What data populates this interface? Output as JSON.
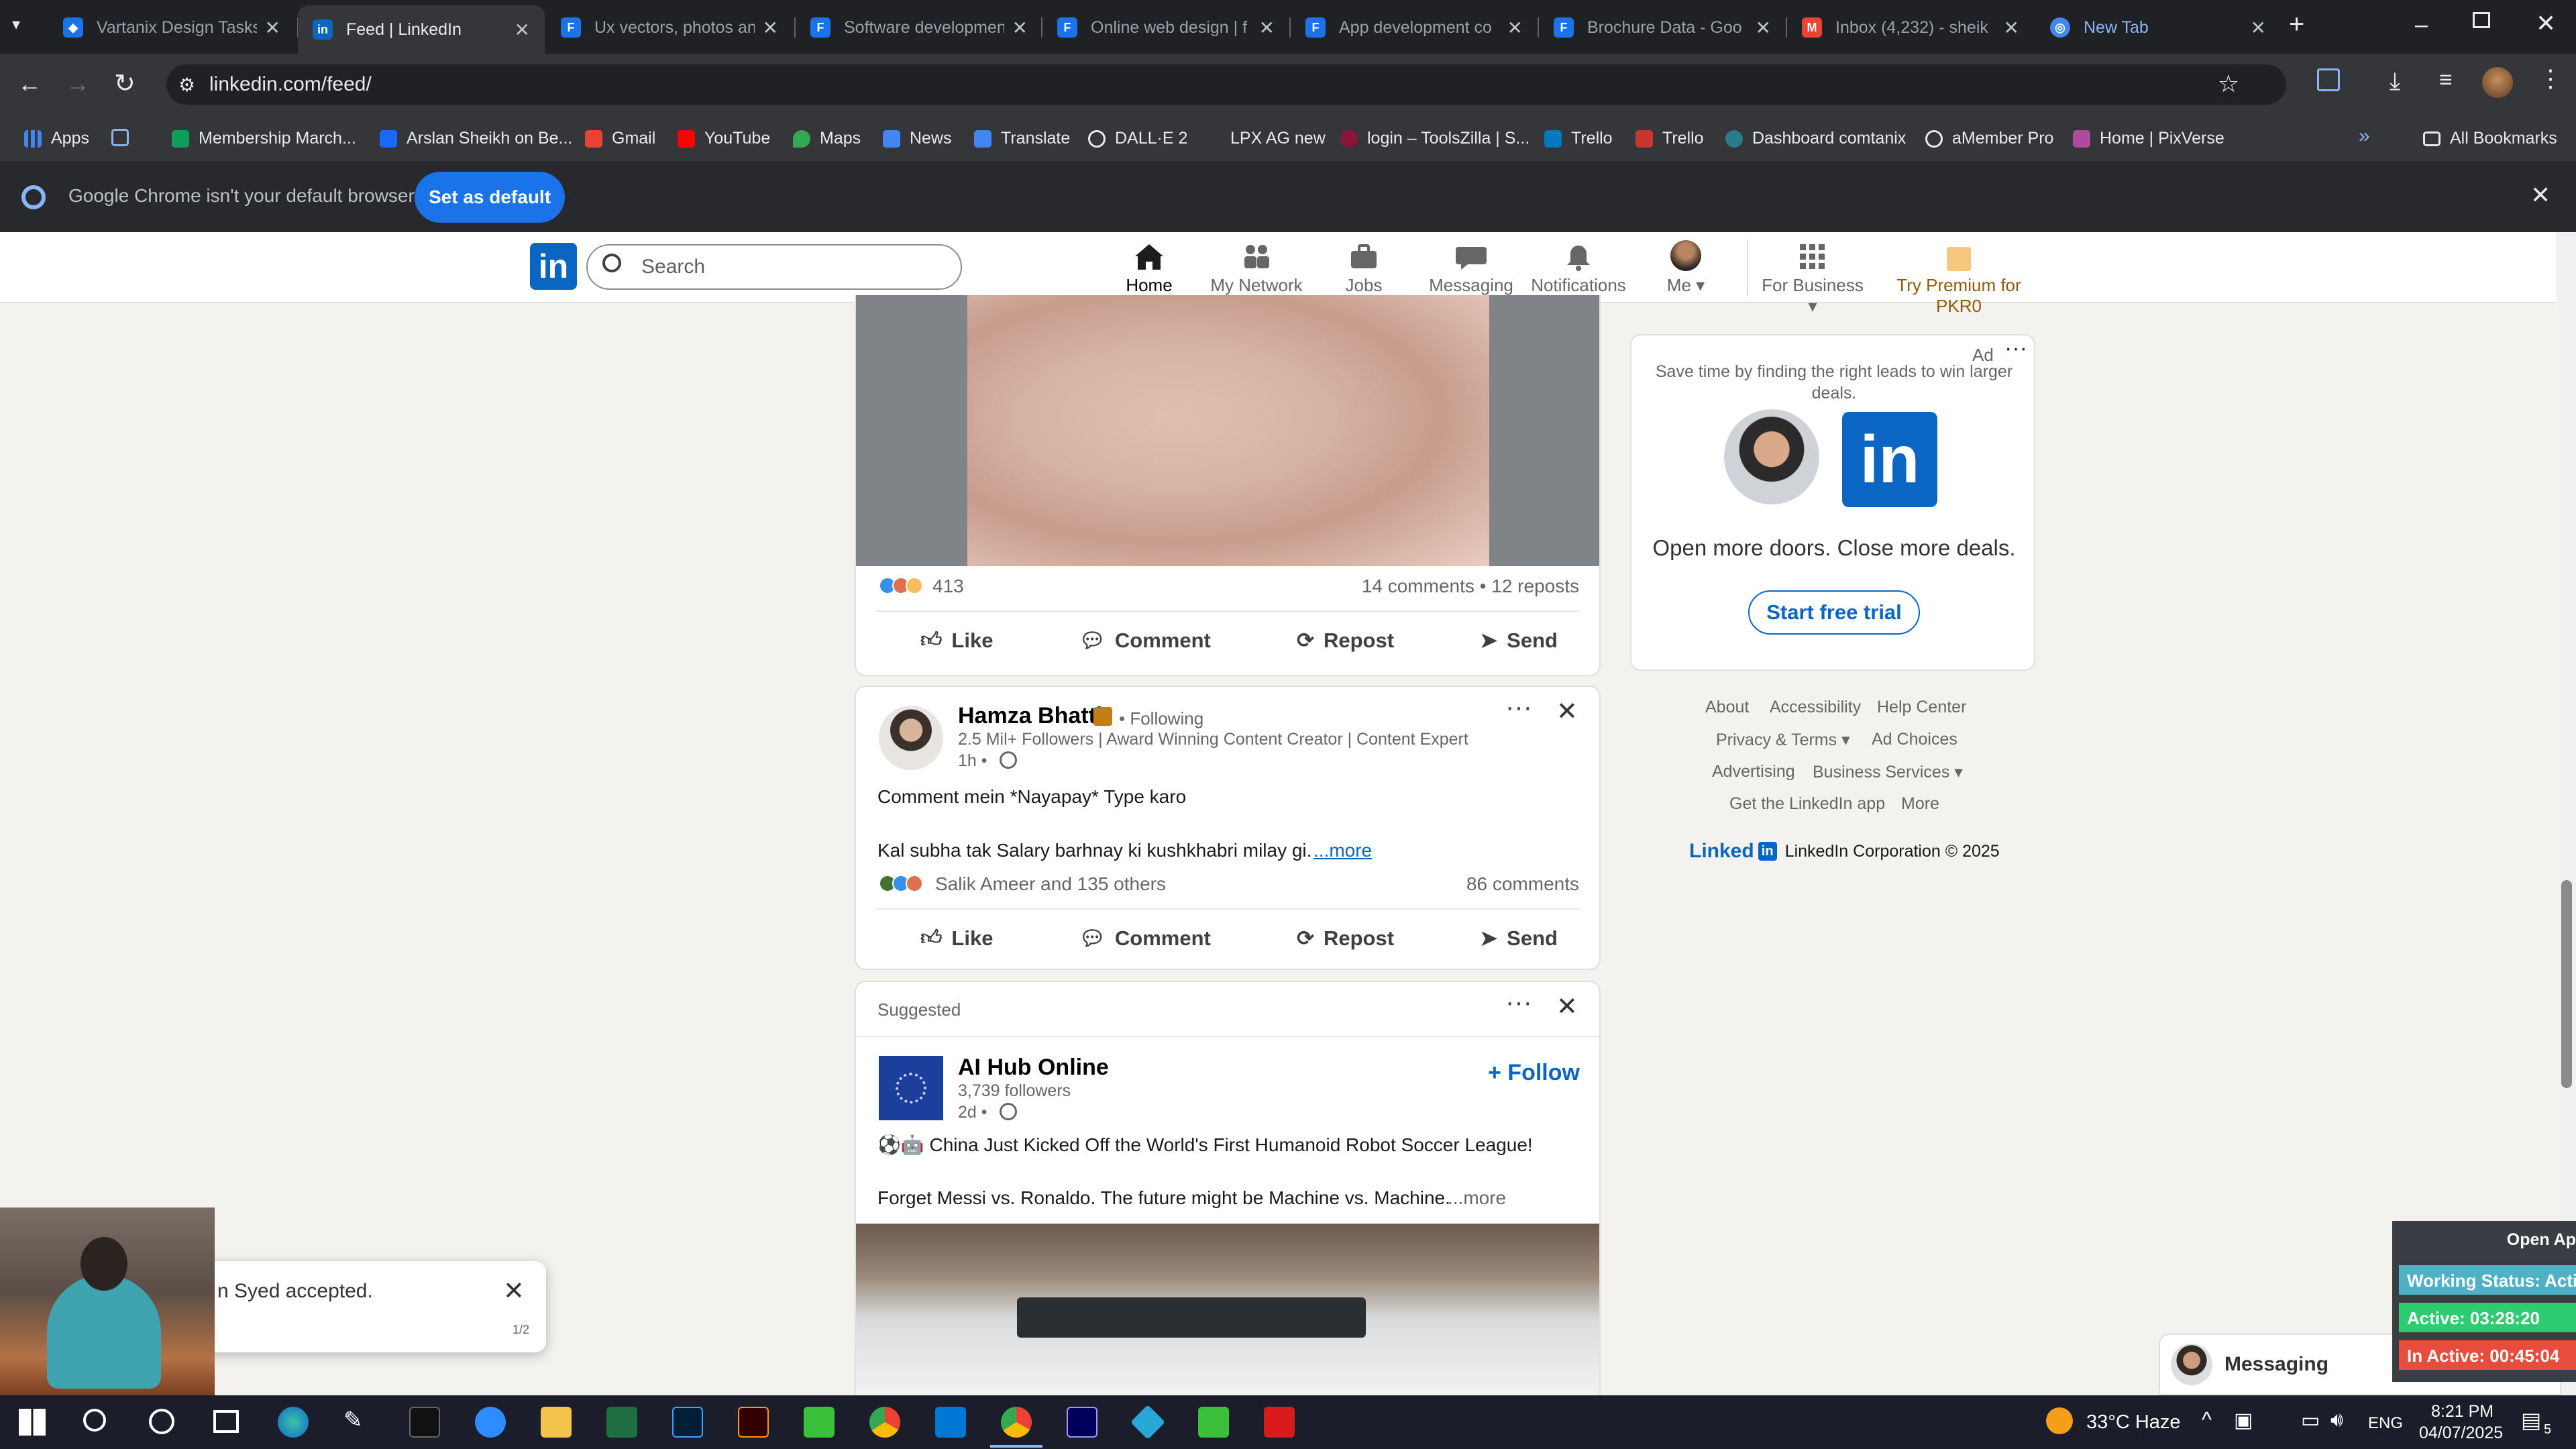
{
  "browser": {
    "tabs": [
      {
        "title": "Vartanix Design Tasks",
        "color": "#1a73e8"
      },
      {
        "title": "Feed | LinkedIn",
        "color": "#0a66c2"
      },
      {
        "title": "Ux vectors, photos an",
        "color": "#1a73e8"
      },
      {
        "title": "Software developmen",
        "color": "#1a73e8"
      },
      {
        "title": "Online web design | f",
        "color": "#1a73e8"
      },
      {
        "title": "App development co",
        "color": "#1a73e8"
      },
      {
        "title": "Brochure Data - Goo",
        "color": "#1a73e8"
      },
      {
        "title": "Inbox (4,232) - sheik",
        "color": "#ea4335"
      },
      {
        "title": "New Tab",
        "color": "#4285f4"
      }
    ],
    "url": "linkedin.com/feed/",
    "bookmarks": [
      "Apps",
      "Membership March...",
      "Arslan Sheikh on Be...",
      "Gmail",
      "YouTube",
      "Maps",
      "News",
      "Translate",
      "DALL·E 2",
      "LPX AG new",
      "login – ToolsZilla | S...",
      "Trello",
      "Trello",
      "Dashboard comtanix",
      "aMember Pro",
      "Home | PixVerse"
    ],
    "all_bookmarks": "All Bookmarks",
    "infobar": {
      "message": "Google Chrome isn't your default browser",
      "button": "Set as default"
    }
  },
  "linkedin": {
    "search_placeholder": "Search",
    "nav": [
      {
        "label": "Home"
      },
      {
        "label": "My Network"
      },
      {
        "label": "Jobs"
      },
      {
        "label": "Messaging"
      },
      {
        "label": "Notifications"
      },
      {
        "label": "Me ▾"
      },
      {
        "label": "For Business ▾"
      },
      {
        "label": "Try Premium for PKR0"
      }
    ],
    "post1": {
      "reaction_count": "413",
      "comments": "14 comments • 12 reposts"
    },
    "actions": [
      "Like",
      "Comment",
      "Repost",
      "Send"
    ],
    "post2": {
      "author": "Hamza Bhatti",
      "following": "• Following",
      "subtitle": "2.5 Mil+ Followers | Award Winning Content Creator | Content Expert",
      "time": "1h •",
      "line1": "Comment mein *Nayapay* Type karo",
      "line2": "Kal subha tak Salary barhnay ki kushkhabri milay gi.",
      "more": "...more",
      "reactions": "Salik Ameer and 135 others",
      "comments": "86 comments"
    },
    "post3": {
      "label": "Suggested",
      "author": "AI Hub Online",
      "followers": "3,739 followers",
      "time": "2d •",
      "follow": "+ Follow",
      "line1": "⚽🤖 China Just Kicked Off the World's First Humanoid Robot Soccer League!",
      "line2": "Forget Messi vs. Ronaldo. The future might be Machine vs. Machine.",
      "more": "...more"
    },
    "ad": {
      "label": "Ad",
      "text": "Save time by finding the right leads to win larger deals.",
      "headline": "Open more doors. Close more deals.",
      "button": "Start free trial"
    },
    "footer": {
      "row1": [
        "About",
        "Accessibility",
        "Help Center"
      ],
      "row2": [
        "Privacy & Terms ▾",
        "Ad Choices"
      ],
      "row3": [
        "Advertising",
        "Business Services ▾"
      ],
      "row4": [
        "Get the LinkedIn app",
        "More"
      ],
      "brand": "Linked",
      "copyright": "LinkedIn Corporation © 2025"
    },
    "messaging": "Messaging",
    "toast": {
      "text": "n Syed accepted.",
      "page": "1/2"
    }
  },
  "overlay": {
    "open_app": "Open Ap",
    "working": "Working Status: Activ",
    "active": "Active: 03:28:20",
    "inactive": "In Active: 00:45:04"
  },
  "taskbar": {
    "weather": "33°C Haze",
    "lang": "ENG",
    "time": "8:21 PM",
    "date": "04/07/2025",
    "notif": "5"
  }
}
